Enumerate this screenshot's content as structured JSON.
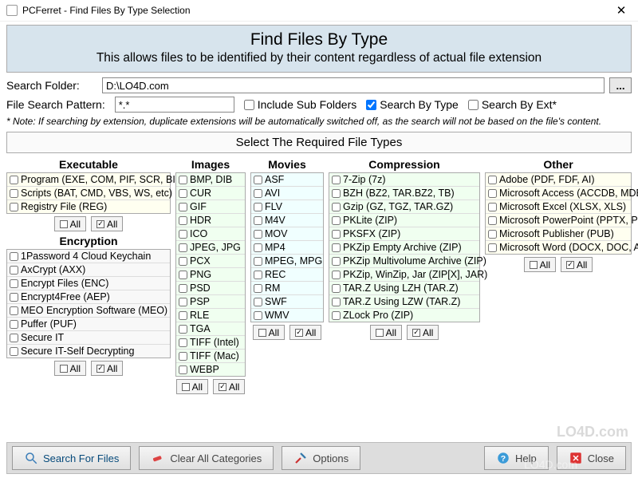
{
  "window": {
    "title": "PCFerret - Find Files By Type Selection"
  },
  "banner": {
    "heading": "Find Files By Type",
    "subheading": "This allows files to be identified by their content regardless of actual file extension"
  },
  "search_folder": {
    "label": "Search Folder:",
    "value": "D:\\LO4D.com",
    "browse_label": "..."
  },
  "file_pattern": {
    "label": "File Search Pattern:",
    "value": "*.*"
  },
  "options": {
    "include_sub": {
      "label": "Include Sub Folders",
      "checked": false
    },
    "by_type": {
      "label": "Search By Type",
      "checked": true
    },
    "by_ext": {
      "label": "Search By Ext*",
      "checked": false
    }
  },
  "note": "* Note: If searching by extension, duplicate extensions will be automatically switched off, as the search will not be based on the file's content.",
  "section_title": "Select The Required File Types",
  "btn_all": "All",
  "categories": {
    "executable": {
      "title": "Executable",
      "items": [
        "Program (EXE, COM, PIF, SCR, BIN)",
        "Scripts (BAT, CMD, VBS, WS, etc)",
        "Registry File (REG)"
      ]
    },
    "encryption": {
      "title": "Encryption",
      "items": [
        "1Password 4 Cloud Keychain",
        "AxCrypt (AXX)",
        "Encrypt Files (ENC)",
        "Encrypt4Free (AEP)",
        "MEO Encryption Software (MEO)",
        "Puffer (PUF)",
        "Secure IT",
        "Secure IT-Self Decrypting"
      ]
    },
    "images": {
      "title": "Images",
      "items": [
        "BMP, DIB",
        "CUR",
        "GIF",
        "HDR",
        "ICO",
        "JPEG, JPG",
        "PCX",
        "PNG",
        "PSD",
        "PSP",
        "RLE",
        "TGA",
        "TIFF (Intel)",
        "TIFF (Mac)",
        "WEBP"
      ]
    },
    "movies": {
      "title": "Movies",
      "items": [
        "ASF",
        "AVI",
        "FLV",
        "M4V",
        "MOV",
        "MP4",
        "MPEG, MPG",
        "REC",
        "RM",
        "SWF",
        "WMV"
      ]
    },
    "compression": {
      "title": "Compression",
      "items": [
        "7-Zip (7z)",
        "BZH (BZ2, TAR.BZ2, TB)",
        "Gzip (GZ, TGZ, TAR.GZ)",
        "PKLite (ZIP)",
        "PKSFX (ZIP)",
        "PKZip Empty Archive (ZIP)",
        "PKZip Multivolume Archive (ZIP)",
        "PKZip, WinZip, Jar (ZIP[X], JAR)",
        "TAR.Z Using LZH (TAR.Z)",
        "TAR.Z Using LZW (TAR.Z)",
        "ZLock Pro (ZIP)"
      ]
    },
    "other": {
      "title": "Other",
      "items": [
        "Adobe (PDF, FDF, AI)",
        "Microsoft Access (ACCDB, MDB)",
        "Microsoft Excel (XLSX, XLS)",
        "Microsoft PowerPoint (PPTX, PPT)",
        "Microsoft Publisher (PUB)",
        "Microsoft Word (DOCX, DOC, ASD)"
      ]
    }
  },
  "footer": {
    "search": "Search For Files",
    "clear": "Clear All Categories",
    "options": "Options",
    "help": "Help",
    "close": "Close"
  },
  "watermark": "LO4D.com"
}
